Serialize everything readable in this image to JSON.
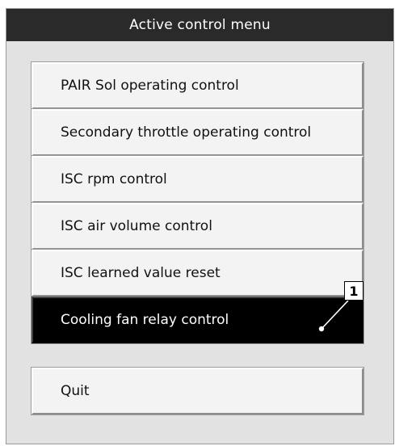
{
  "window": {
    "title": "Active control menu"
  },
  "menu": {
    "items": [
      {
        "label": "PAIR Sol operating control",
        "selected": false
      },
      {
        "label": "Secondary throttle operating control",
        "selected": false
      },
      {
        "label": "ISC rpm control",
        "selected": false
      },
      {
        "label": "ISC air volume control",
        "selected": false
      },
      {
        "label": "ISC learned value reset",
        "selected": false
      },
      {
        "label": "Cooling fan relay control",
        "selected": true
      }
    ],
    "quit_label": "Quit"
  },
  "callout": {
    "number": "1"
  },
  "colors": {
    "titlebar": "#2a2a2a",
    "window_bg": "#e2e2e2",
    "button_bg": "#f3f3f3",
    "selected_bg": "#000000",
    "selected_text": "#ffffff"
  }
}
